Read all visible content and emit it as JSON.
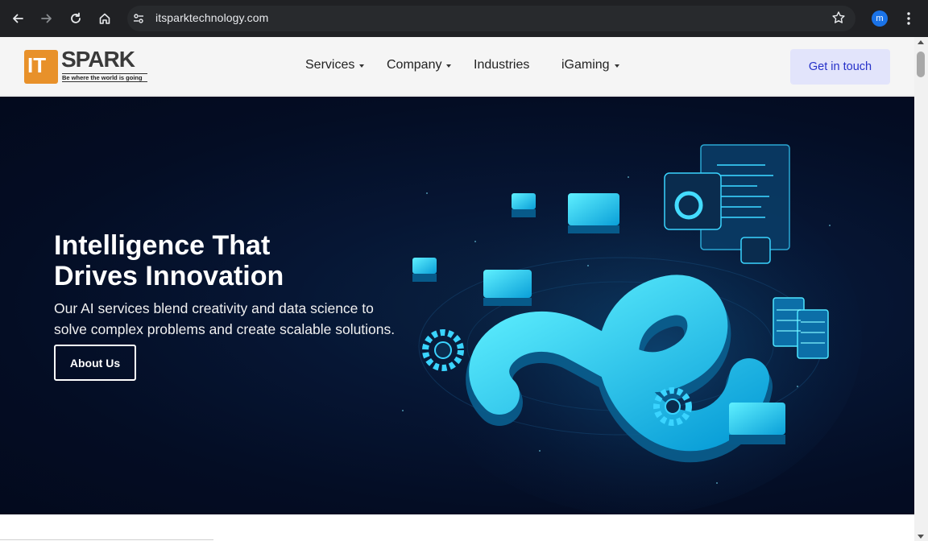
{
  "browser": {
    "url": "itsparktechnology.com",
    "profile_initial": "m",
    "icons": [
      "back-icon",
      "forward-icon",
      "reload-icon",
      "home-icon",
      "site-info-icon",
      "bookmark-star-icon",
      "menu-kebab-icon"
    ]
  },
  "header": {
    "logo": {
      "it": "IT",
      "spark": "SPARK",
      "tagline": "Be where the world is going"
    },
    "nav": [
      {
        "label": "Services",
        "has_dropdown": true
      },
      {
        "label": "Company",
        "has_dropdown": true
      },
      {
        "label": "Industries",
        "has_dropdown": false
      },
      {
        "label": "iGaming",
        "has_dropdown": true
      }
    ],
    "cta_label": "Get in touch"
  },
  "hero": {
    "title_line1": "Intelligence That",
    "title_line2": "Drives Innovation",
    "subtitle_line1": "Our AI services blend creativity and data science to",
    "subtitle_line2": "solve complex problems and create scalable solutions.",
    "button_label": "About Us"
  },
  "colors": {
    "chrome_bg": "#202124",
    "hero_bg": "#061634",
    "accent_cyan": "#18d8ff",
    "logo_orange": "#e8912a",
    "cta_bg": "#e2e4fb",
    "cta_text": "#2631c9"
  }
}
